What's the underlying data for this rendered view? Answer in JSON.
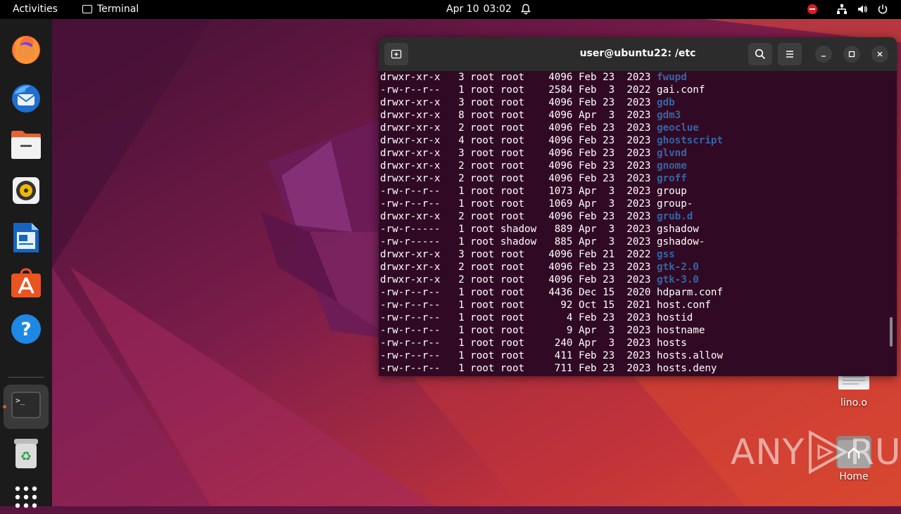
{
  "topbar": {
    "activities": "Activities",
    "app_name": "Terminal",
    "date": "Apr 10",
    "time": "03:02"
  },
  "dock": {
    "items": [
      "firefox-icon",
      "thunderbird-icon",
      "files-icon",
      "rhythmbox-icon",
      "libreoffice-writer-icon",
      "app-center-icon",
      "help-icon",
      "terminal-icon",
      "trash-icon",
      "show-apps-icon"
    ]
  },
  "terminal": {
    "title": "user@ubuntu22: /etc",
    "lines": [
      {
        "perm": "drwxr-xr-x",
        "links": "3",
        "user": "root",
        "group": "root",
        "size": "4096",
        "month": "Feb",
        "day": "23",
        "year": "2023",
        "name": "fwupd",
        "dir": true
      },
      {
        "perm": "-rw-r--r--",
        "links": "1",
        "user": "root",
        "group": "root",
        "size": "2584",
        "month": "Feb",
        "day": "3",
        "year": "2022",
        "name": "gai.conf",
        "dir": false
      },
      {
        "perm": "drwxr-xr-x",
        "links": "3",
        "user": "root",
        "group": "root",
        "size": "4096",
        "month": "Feb",
        "day": "23",
        "year": "2023",
        "name": "gdb",
        "dir": true
      },
      {
        "perm": "drwxr-xr-x",
        "links": "8",
        "user": "root",
        "group": "root",
        "size": "4096",
        "month": "Apr",
        "day": "3",
        "year": "2023",
        "name": "gdm3",
        "dir": true
      },
      {
        "perm": "drwxr-xr-x",
        "links": "2",
        "user": "root",
        "group": "root",
        "size": "4096",
        "month": "Feb",
        "day": "23",
        "year": "2023",
        "name": "geoclue",
        "dir": true
      },
      {
        "perm": "drwxr-xr-x",
        "links": "4",
        "user": "root",
        "group": "root",
        "size": "4096",
        "month": "Feb",
        "day": "23",
        "year": "2023",
        "name": "ghostscript",
        "dir": true
      },
      {
        "perm": "drwxr-xr-x",
        "links": "3",
        "user": "root",
        "group": "root",
        "size": "4096",
        "month": "Feb",
        "day": "23",
        "year": "2023",
        "name": "glvnd",
        "dir": true
      },
      {
        "perm": "drwxr-xr-x",
        "links": "2",
        "user": "root",
        "group": "root",
        "size": "4096",
        "month": "Feb",
        "day": "23",
        "year": "2023",
        "name": "gnome",
        "dir": true
      },
      {
        "perm": "drwxr-xr-x",
        "links": "2",
        "user": "root",
        "group": "root",
        "size": "4096",
        "month": "Feb",
        "day": "23",
        "year": "2023",
        "name": "groff",
        "dir": true
      },
      {
        "perm": "-rw-r--r--",
        "links": "1",
        "user": "root",
        "group": "root",
        "size": "1073",
        "month": "Apr",
        "day": "3",
        "year": "2023",
        "name": "group",
        "dir": false
      },
      {
        "perm": "-rw-r--r--",
        "links": "1",
        "user": "root",
        "group": "root",
        "size": "1069",
        "month": "Apr",
        "day": "3",
        "year": "2023",
        "name": "group-",
        "dir": false
      },
      {
        "perm": "drwxr-xr-x",
        "links": "2",
        "user": "root",
        "group": "root",
        "size": "4096",
        "month": "Feb",
        "day": "23",
        "year": "2023",
        "name": "grub.d",
        "dir": true
      },
      {
        "perm": "-rw-r-----",
        "links": "1",
        "user": "root",
        "group": "shadow",
        "size": "889",
        "month": "Apr",
        "day": "3",
        "year": "2023",
        "name": "gshadow",
        "dir": false
      },
      {
        "perm": "-rw-r-----",
        "links": "1",
        "user": "root",
        "group": "shadow",
        "size": "885",
        "month": "Apr",
        "day": "3",
        "year": "2023",
        "name": "gshadow-",
        "dir": false
      },
      {
        "perm": "drwxr-xr-x",
        "links": "3",
        "user": "root",
        "group": "root",
        "size": "4096",
        "month": "Feb",
        "day": "21",
        "year": "2022",
        "name": "gss",
        "dir": true
      },
      {
        "perm": "drwxr-xr-x",
        "links": "2",
        "user": "root",
        "group": "root",
        "size": "4096",
        "month": "Feb",
        "day": "23",
        "year": "2023",
        "name": "gtk-2.0",
        "dir": true
      },
      {
        "perm": "drwxr-xr-x",
        "links": "2",
        "user": "root",
        "group": "root",
        "size": "4096",
        "month": "Feb",
        "day": "23",
        "year": "2023",
        "name": "gtk-3.0",
        "dir": true
      },
      {
        "perm": "-rw-r--r--",
        "links": "1",
        "user": "root",
        "group": "root",
        "size": "4436",
        "month": "Dec",
        "day": "15",
        "year": "2020",
        "name": "hdparm.conf",
        "dir": false
      },
      {
        "perm": "-rw-r--r--",
        "links": "1",
        "user": "root",
        "group": "root",
        "size": "92",
        "month": "Oct",
        "day": "15",
        "year": "2021",
        "name": "host.conf",
        "dir": false
      },
      {
        "perm": "-rw-r--r--",
        "links": "1",
        "user": "root",
        "group": "root",
        "size": "4",
        "month": "Feb",
        "day": "23",
        "year": "2023",
        "name": "hostid",
        "dir": false
      },
      {
        "perm": "-rw-r--r--",
        "links": "1",
        "user": "root",
        "group": "root",
        "size": "9",
        "month": "Apr",
        "day": "3",
        "year": "2023",
        "name": "hostname",
        "dir": false
      },
      {
        "perm": "-rw-r--r--",
        "links": "1",
        "user": "root",
        "group": "root",
        "size": "240",
        "month": "Apr",
        "day": "3",
        "year": "2023",
        "name": "hosts",
        "dir": false
      },
      {
        "perm": "-rw-r--r--",
        "links": "1",
        "user": "root",
        "group": "root",
        "size": "411",
        "month": "Feb",
        "day": "23",
        "year": "2023",
        "name": "hosts.allow",
        "dir": false
      },
      {
        "perm": "-rw-r--r--",
        "links": "1",
        "user": "root",
        "group": "root",
        "size": "711",
        "month": "Feb",
        "day": "23",
        "year": "2023",
        "name": "hosts.deny",
        "dir": false
      }
    ]
  },
  "desktop": {
    "icons": [
      {
        "label": "lino.o"
      },
      {
        "label": "Home"
      }
    ]
  },
  "watermark": {
    "left": "ANY",
    "right": "RUN"
  },
  "colors": {
    "accent": "#e95420",
    "terminal_bg": "#300a24",
    "dir_color": "#3465a4"
  }
}
